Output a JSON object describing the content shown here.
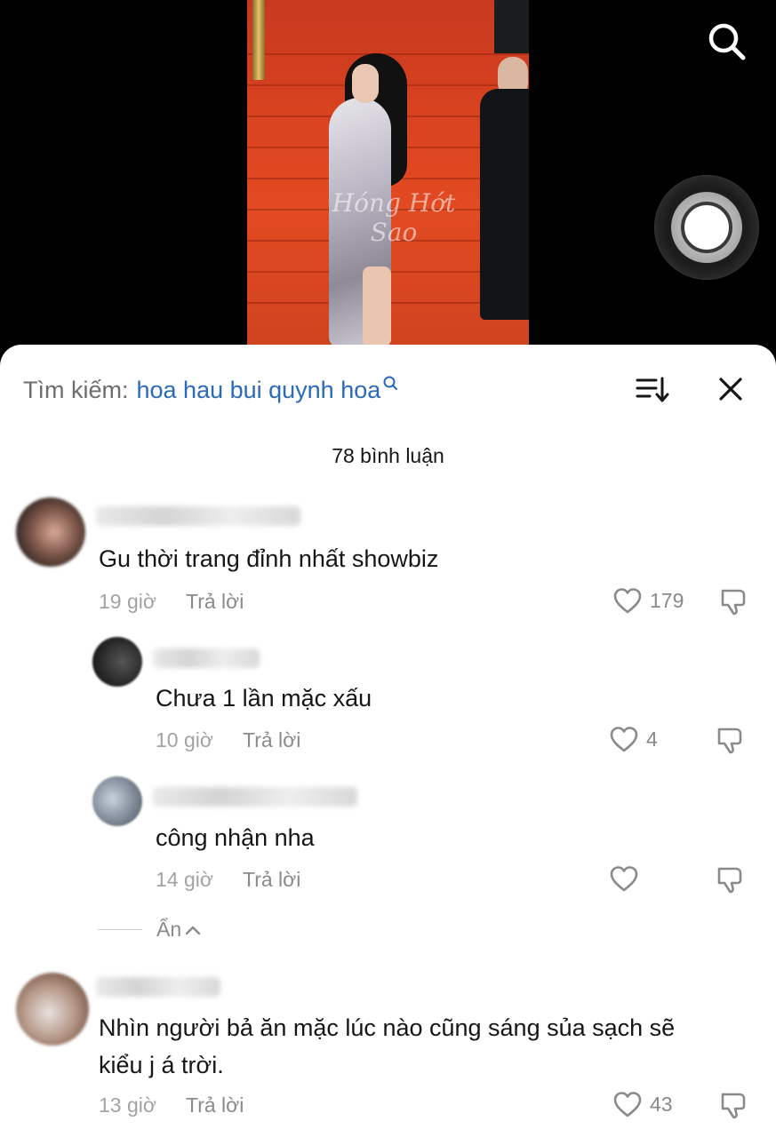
{
  "video": {
    "watermark": "Hóng Hớt Sao"
  },
  "sheet": {
    "search_prefix": "Tìm kiếm:",
    "search_query": "hoa hau bui quynh hoa",
    "comment_count": "78 bình luận",
    "hide_label": "Ẩn"
  },
  "comments": [
    {
      "text": "Gu thời trang đỉnh nhất showbiz",
      "time": "19 giờ",
      "reply": "Trả lời",
      "likes": "179"
    },
    {
      "text": "Chưa 1 lần mặc xấu",
      "time": "10 giờ",
      "reply": "Trả lời",
      "likes": "4"
    },
    {
      "text": "công nhận nha",
      "time": "14 giờ",
      "reply": "Trả lời",
      "likes": ""
    },
    {
      "text_line1": "Nhìn người bả ăn mặc lúc nào cũng sáng sủa sạch sẽ",
      "text_line2": "kiểu j á trời.",
      "time": "13 giờ",
      "reply": "Trả lời",
      "likes": "43"
    }
  ],
  "colors": {
    "query": "#2a6ab8",
    "muted": "#8a8a8a",
    "carpet": "#d9431f"
  }
}
